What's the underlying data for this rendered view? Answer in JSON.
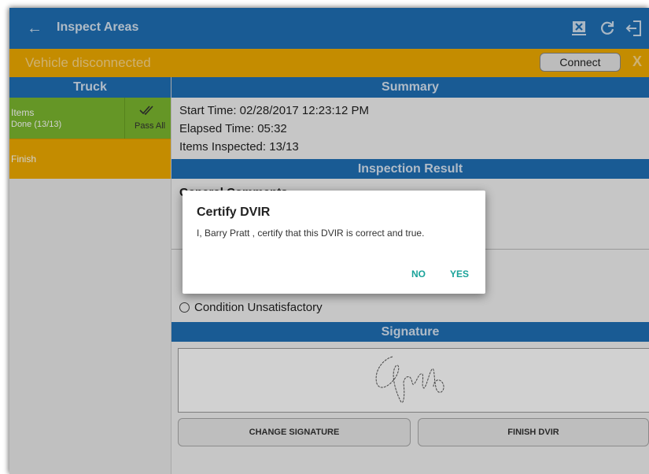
{
  "appbar": {
    "title": "Inspect Areas",
    "back_icon": "arrow-left-icon",
    "icons": [
      "dvir-report-icon",
      "refresh-icon",
      "logout-icon"
    ]
  },
  "banner": {
    "text": "Vehicle disconnected",
    "connect_label": "Connect",
    "close_label": "X"
  },
  "left_panel": {
    "header": "Truck",
    "items": {
      "label": "Items",
      "status": "Done (13/13)",
      "pass_all_label": "Pass All"
    },
    "finish_label": "Finish"
  },
  "summary": {
    "header": "Summary",
    "start_time": "Start Time: 02/28/2017 12:23:12 PM",
    "elapsed_time": "Elapsed Time: 05:32",
    "items_inspected": "Items Inspected: 13/13"
  },
  "inspection_result": {
    "header": "Inspection Result",
    "comments_label": "General Comments",
    "condition_unsatisfactory": "Condition Unsatisfactory"
  },
  "signature": {
    "header": "Signature",
    "change_label": "CHANGE SIGNATURE",
    "finish_label": "FINISH DVIR"
  },
  "dialog": {
    "title": "Certify DVIR",
    "message": "I, Barry Pratt , certify that this DVIR is correct and true.",
    "no_label": "NO",
    "yes_label": "YES"
  },
  "colors": {
    "primary": "#1f6fb5",
    "warning": "#f0ab00",
    "pass": "#7cb82f",
    "dialog_accent": "#1aa39a"
  }
}
